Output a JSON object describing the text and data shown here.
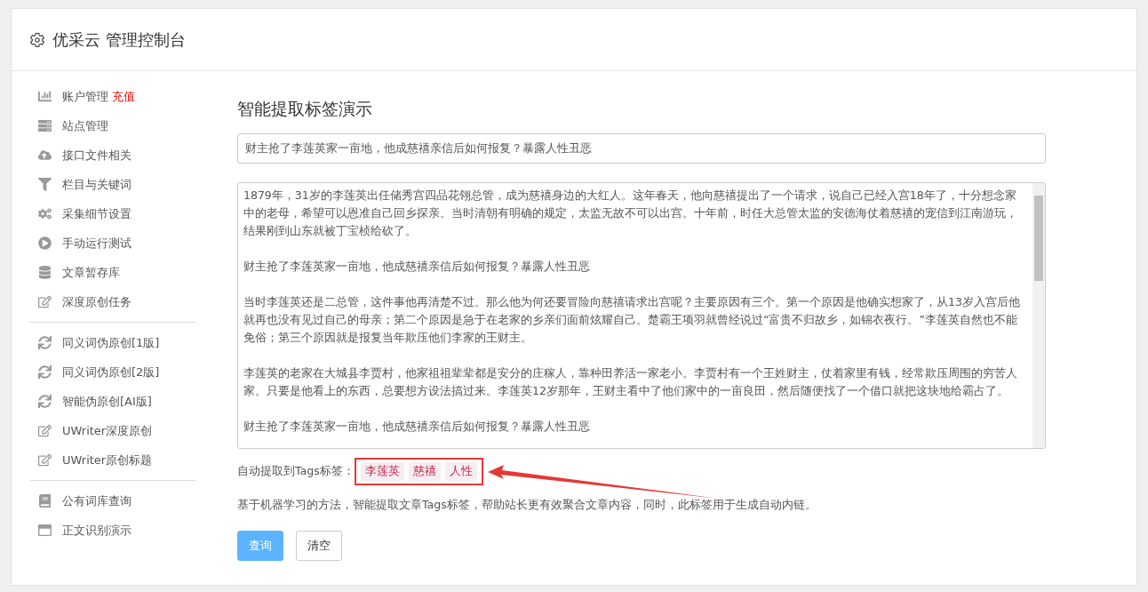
{
  "header": {
    "title": "优采云 管理控制台"
  },
  "sidebar": {
    "items": [
      {
        "kind": "item",
        "label": "账户管理",
        "badge": "充值"
      },
      {
        "kind": "item",
        "label": "站点管理"
      },
      {
        "kind": "item",
        "label": "接口文件相关"
      },
      {
        "kind": "item",
        "label": "栏目与关键词"
      },
      {
        "kind": "item",
        "label": "采集细节设置"
      },
      {
        "kind": "item",
        "label": "手动运行测试"
      },
      {
        "kind": "item",
        "label": "文章暂存库"
      },
      {
        "kind": "item",
        "label": "深度原创任务"
      },
      {
        "kind": "divider"
      },
      {
        "kind": "item",
        "label": "同义词伪原创[1版]"
      },
      {
        "kind": "item",
        "label": "同义词伪原创[2版]"
      },
      {
        "kind": "item",
        "label": "智能伪原创[AI版]"
      },
      {
        "kind": "item",
        "label": "UWriter深度原创"
      },
      {
        "kind": "item",
        "label": "UWriter原创标题"
      },
      {
        "kind": "divider"
      },
      {
        "kind": "item",
        "label": "公有词库查询"
      },
      {
        "kind": "item",
        "label": "正文识别演示"
      }
    ]
  },
  "main": {
    "title": "智能提取标签演示",
    "title_field": {
      "value": "财主抢了李莲英家一亩地，他成慈禧亲信后如何报复？暴露人性丑恶"
    },
    "content_field": {
      "paragraphs": [
        "1879年，31岁的李莲英出任储秀宫四品花翎总管，成为慈禧身边的大红人。这年春天，他向慈禧提出了一个请求，说自己已经入宫18年了，十分想念家中的老母，希望可以恩准自己回乡探亲。当时清朝有明确的规定，太监无故不可以出宫。十年前，时任大总管太监的安德海仗着慈禧的宠信到江南游玩，结果刚到山东就被丁宝桢给砍了。",
        "财主抢了李莲英家一亩地，他成慈禧亲信后如何报复？暴露人性丑恶",
        "当时李莲英还是二总管，这件事他再清楚不过。那么他为何还要冒险向慈禧请求出宫呢？主要原因有三个。第一个原因是他确实想家了，从13岁入宫后他就再也没有见过自己的母亲；第二个原因是急于在老家的乡亲们面前炫耀自己。楚霸王项羽就曾经说过“富贵不归故乡，如锦衣夜行。”李莲英自然也不能免俗；第三个原因就是报复当年欺压他们李家的王财主。",
        "李莲英的老家在大城县李贾村，他家祖祖辈辈都是安分的庄稼人，靠种田养活一家老小。李贾村有一个王姓财主，仗着家里有钱，经常欺压周围的穷苦人家。只要是他看上的东西，总要想方设法搞过来。李莲英12岁那年，王财主看中了他们家中的一亩良田，然后随便找了一个借口就把这块地给霸占了。",
        "财主抢了李莲英家一亩地，他成慈禧亲信后如何报复？暴露人性丑恶"
      ]
    },
    "tags_label": "自动提取到Tags标签：",
    "tags": [
      "李莲英",
      "慈禧",
      "人性"
    ],
    "description": "基于机器学习的方法，智能提取文章Tags标签，帮助站长更有效聚合文章内容，同时，此标签用于生成自动内链。",
    "buttons": [
      {
        "kind": "primary",
        "label": "查询"
      },
      {
        "kind": "default",
        "label": "清空"
      }
    ]
  }
}
